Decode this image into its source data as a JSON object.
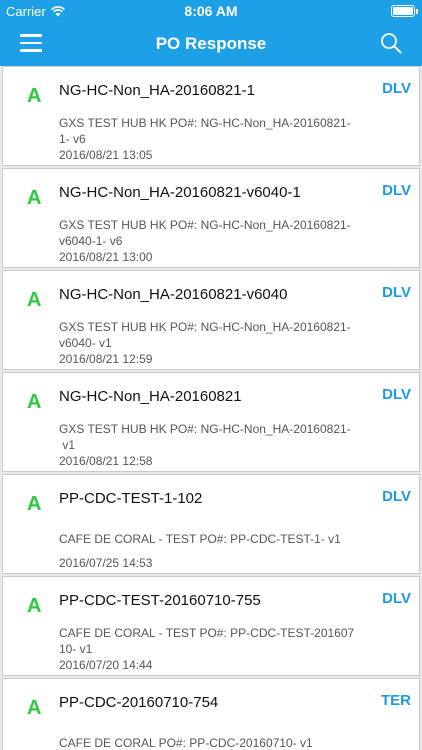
{
  "status_bar": {
    "carrier": "Carrier",
    "time": "8:06 AM"
  },
  "header": {
    "title": "PO Response",
    "menu_icon": "hamburger-menu-icon",
    "search_icon": "search-icon"
  },
  "colors": {
    "accent": "#1ea0e6",
    "status_green": "#2ccb3e",
    "code_blue": "#1e9ae0"
  },
  "items": [
    {
      "status": "A",
      "title": "NG-HC-Non_HA-20160821-1",
      "code": "DLV",
      "desc_line1": "GXS TEST HUB HK PO#: NG-HC-Non_HA-20160821-",
      "desc_line2": "1- v6",
      "date": "2016/08/21 13:05"
    },
    {
      "status": "A",
      "title": "NG-HC-Non_HA-20160821-v6040-1",
      "code": "DLV",
      "desc_line1": "GXS TEST HUB HK PO#: NG-HC-Non_HA-20160821-",
      "desc_line2": "v6040-1- v6",
      "date": "2016/08/21 13:00"
    },
    {
      "status": "A",
      "title": "NG-HC-Non_HA-20160821-v6040",
      "code": "DLV",
      "desc_line1": "GXS TEST HUB HK PO#: NG-HC-Non_HA-20160821-",
      "desc_line2": "v6040- v1",
      "date": "2016/08/21 12:59"
    },
    {
      "status": "A",
      "title": "NG-HC-Non_HA-20160821",
      "code": "DLV",
      "desc_line1": "GXS TEST HUB HK PO#: NG-HC-Non_HA-20160821-",
      "desc_line2": " v1",
      "date": "2016/08/21 12:58"
    },
    {
      "status": "A",
      "title": "PP-CDC-TEST-1-102",
      "code": "DLV",
      "desc_line1": "CAFE DE CORAL - TEST PO#: PP-CDC-TEST-1- v1",
      "desc_line2": "",
      "date": "2016/07/25 14:53"
    },
    {
      "status": "A",
      "title": "PP-CDC-TEST-20160710-755",
      "code": "DLV",
      "desc_line1": "CAFE DE CORAL - TEST PO#: PP-CDC-TEST-201607",
      "desc_line2": "10- v1",
      "date": "2016/07/20 14:44"
    },
    {
      "status": "A",
      "title": "PP-CDC-20160710-754",
      "code": "TER",
      "desc_line1": "CAFE DE CORAL PO#: PP-CDC-20160710- v1",
      "desc_line2": "",
      "date": ""
    }
  ]
}
